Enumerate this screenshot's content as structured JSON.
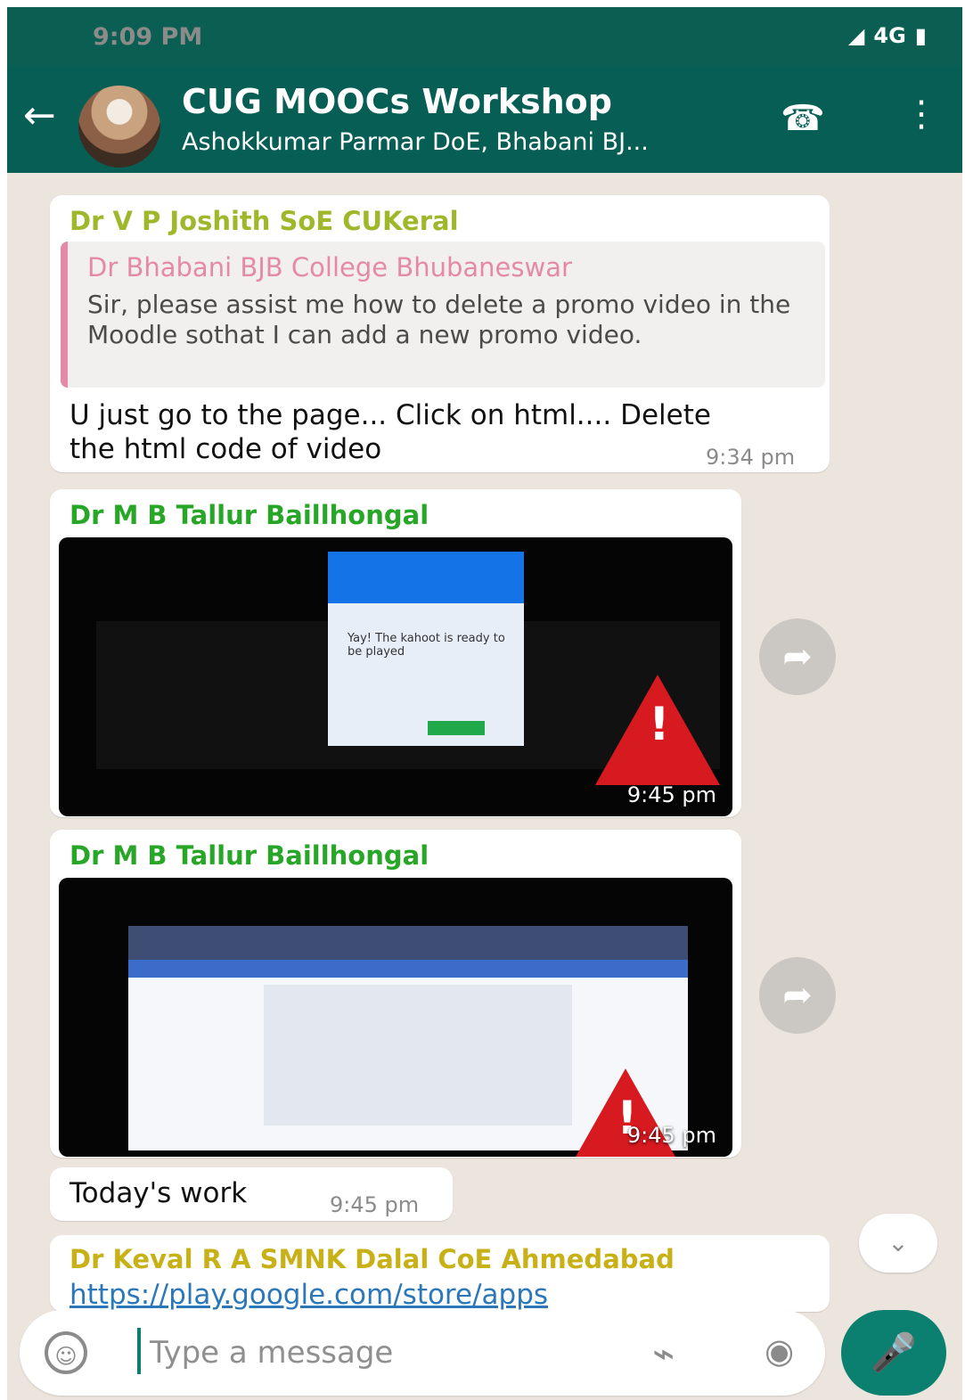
{
  "status_bar": {
    "time": "9:09 PM",
    "network": "4G"
  },
  "header": {
    "title": "CUG MOOCs Workshop",
    "subtitle": "Ashokkumar Parmar DoE, Bhabani BJ..."
  },
  "messages": [
    {
      "sender": "Dr V P Joshith SoE CUKeral",
      "quote_sender": "Dr Bhabani BJB College Bhubaneswar",
      "quote_text": "Sir, please assist me how to delete a promo video in the Moodle sothat I can add a new promo video.",
      "text": "U just go to the page... Click on html.... Delete the html code of video",
      "time": "9:34 pm"
    },
    {
      "sender": "Dr M B Tallur Baillhongal",
      "time": "9:45 pm",
      "image_text": "Yay! The kahoot is ready to be played"
    },
    {
      "sender": "Dr M B Tallur Baillhongal",
      "time": "9:45 pm"
    },
    {
      "text": "Today's work",
      "time": "9:45 pm"
    },
    {
      "sender": "Dr Keval R A SMNK Dalal CoE Ahmedabad",
      "text": "https://play.google.com/store/apps"
    }
  ],
  "input": {
    "placeholder": "Type a message"
  },
  "colors": {
    "header": "#075E54",
    "accent": "#0b7f70",
    "sender_green": "#27a627",
    "sender_lime": "#9fb82b",
    "sender_gold": "#c7b117",
    "quote_pink": "#e48aa8",
    "chat_background": "#ECE5DD"
  },
  "icons": [
    "back-arrow-icon",
    "add-call-icon",
    "more-options-icon",
    "forward-icon",
    "emoji-icon",
    "attach-icon",
    "camera-icon",
    "microphone-icon",
    "chevron-down-icon"
  ]
}
